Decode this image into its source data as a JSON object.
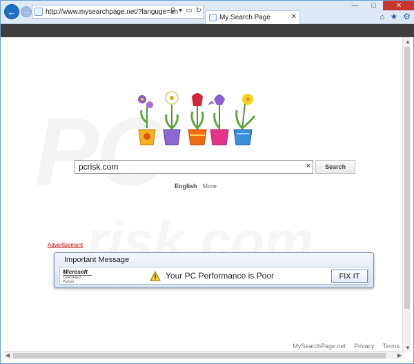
{
  "browser": {
    "address_url": "http://www.mysearchpage.net/?languge=en",
    "tab_title": "My Search Page",
    "icons": [
      "back-arrow-icon",
      "forward-arrow-icon",
      "search-icon",
      "dropdown-icon",
      "lock-icon",
      "refresh-icon",
      "tab-close-icon",
      "home-icon",
      "star-icon",
      "gear-icon",
      "minimize-icon",
      "maximize-icon",
      "close-icon"
    ],
    "colors": {
      "back_button": "#1f6fc4",
      "command_bar": "#3f3f3f",
      "close_button": "#c7372f"
    }
  },
  "search": {
    "query": "pcrisk.com",
    "button_label": "Search",
    "clear_label": "×"
  },
  "languages": {
    "current": "English",
    "more": "More"
  },
  "ad": {
    "link_text": "Advertisement",
    "title": "Important Message",
    "message": "Your PC Performance is Poor",
    "button_label": "FIX IT",
    "logo_text": "Microsoft",
    "logo_sub": "CERTIFIED Partner",
    "colors": {
      "link": "#cc0000"
    }
  },
  "footer": {
    "links": [
      "MySearchPage.net",
      "Privacy",
      "Terms"
    ]
  }
}
